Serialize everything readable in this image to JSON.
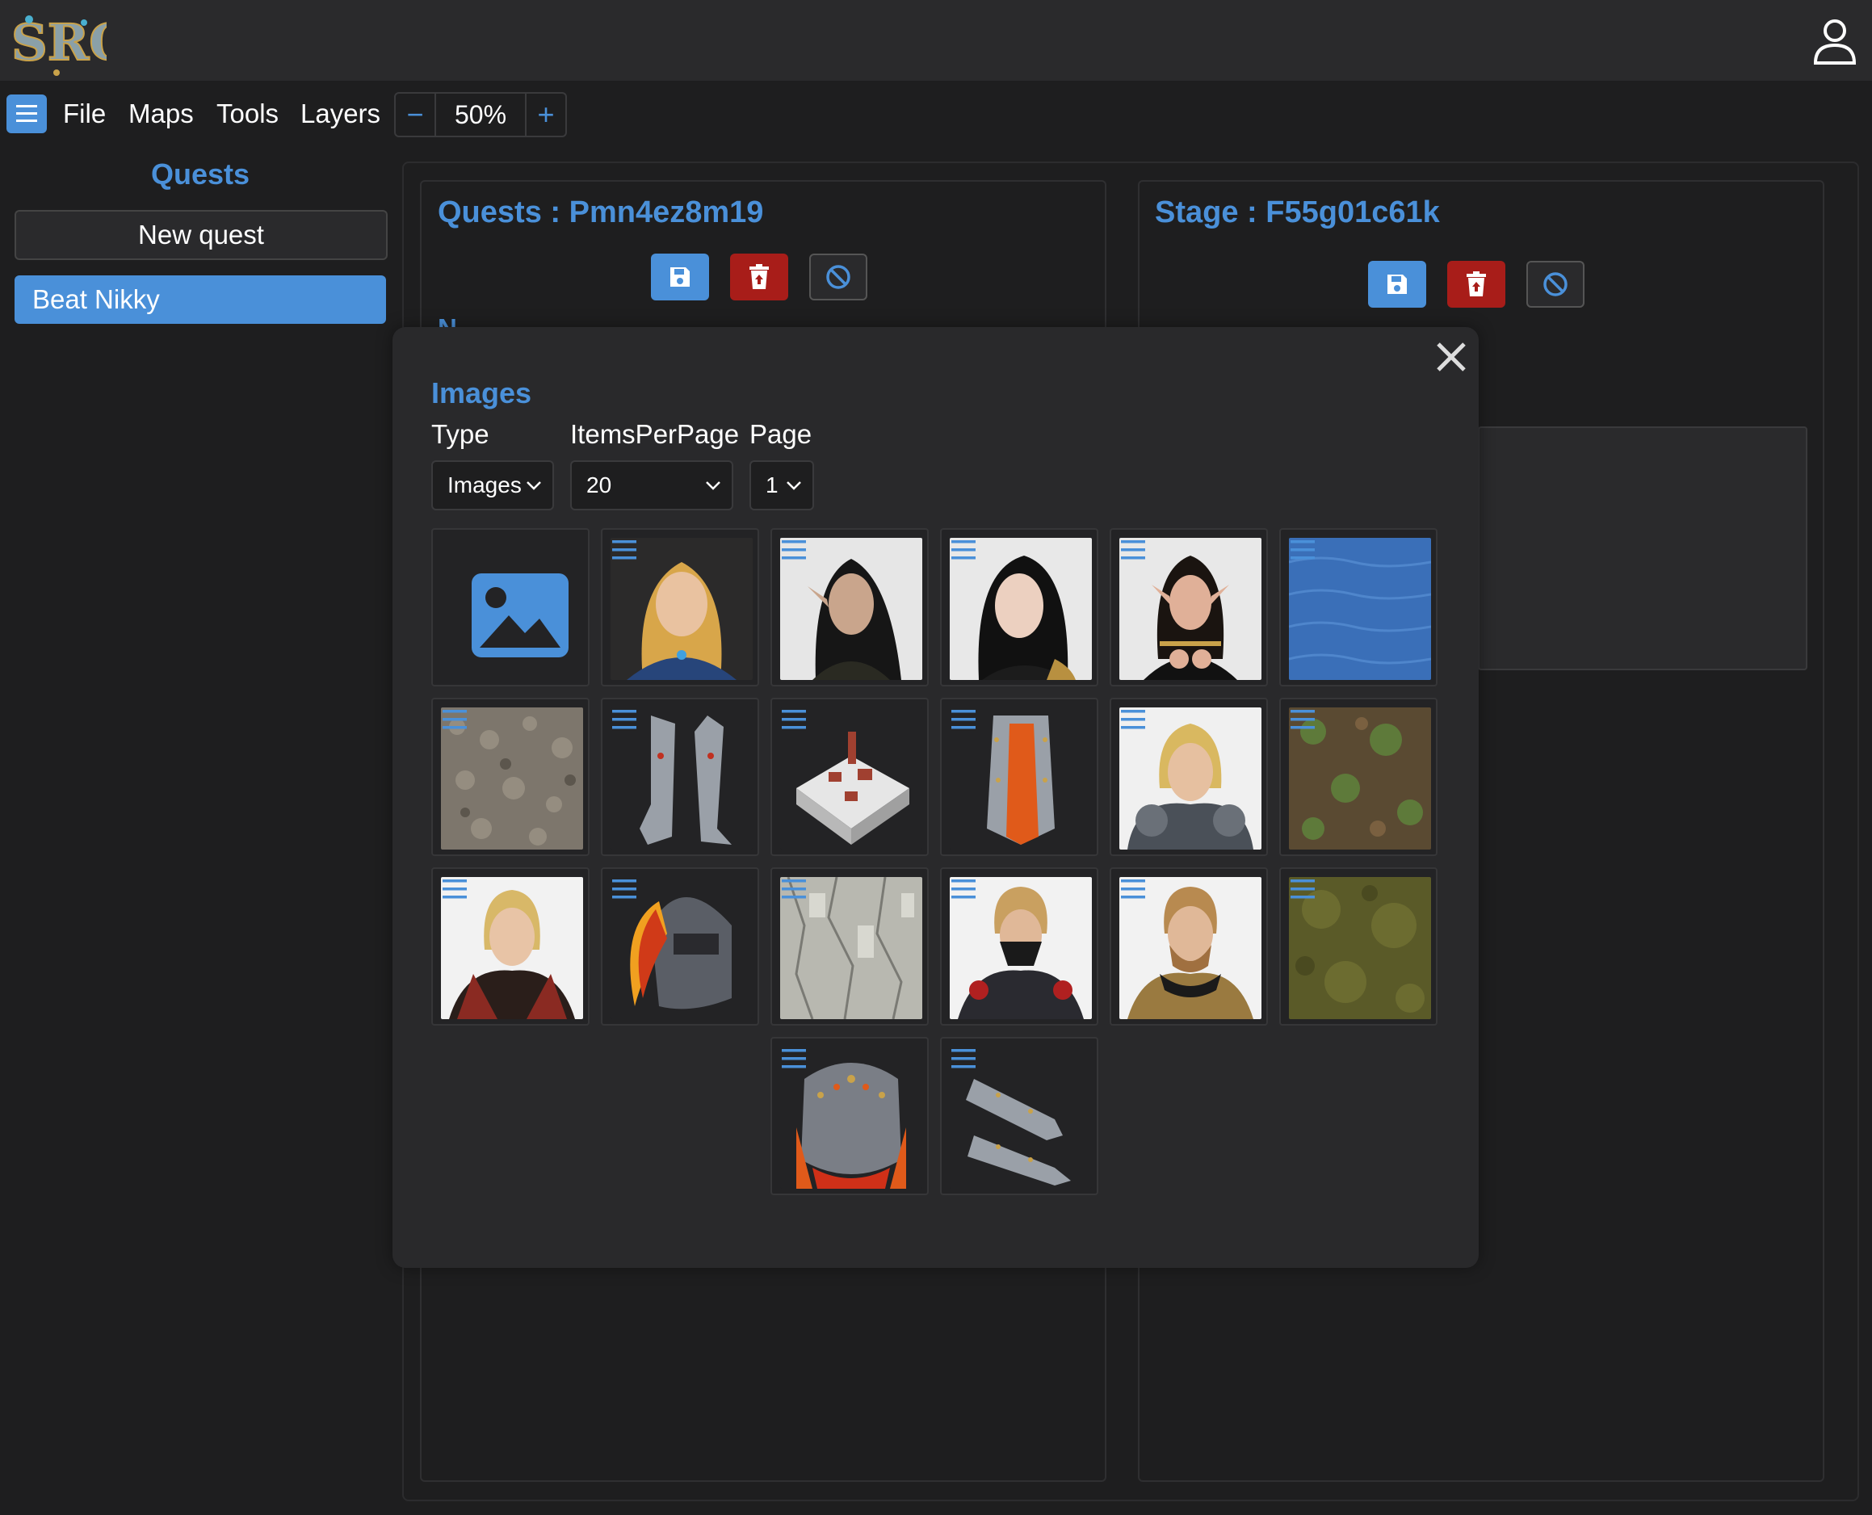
{
  "header": {
    "logo_text": "SRQ",
    "user_icon": "user-icon"
  },
  "menubar": {
    "hamburger_icon": "menu-icon",
    "items": [
      {
        "label": "File"
      },
      {
        "label": "Maps"
      },
      {
        "label": "Tools"
      },
      {
        "label": "Layers"
      }
    ],
    "zoom": {
      "minus": "−",
      "value": "50%",
      "plus": "+"
    }
  },
  "sidebar": {
    "title": "Quests",
    "new_button": "New quest",
    "items": [
      {
        "label": "Beat Nikky",
        "selected": true
      }
    ]
  },
  "quest_panel": {
    "title": "Quests : Pmn4ez8m19",
    "partial_label": "N"
  },
  "stage_panel": {
    "title": "Stage : F55g01c61k"
  },
  "modal": {
    "title": "Images",
    "fields": {
      "type_label": "Type",
      "items_label": "ItemsPerPage",
      "page_label": "Page"
    },
    "type_value": "Images",
    "items_value": "20",
    "page_value": "1",
    "tiles": [
      {
        "name": "add-image",
        "kind": "placeholder"
      },
      {
        "name": "blonde-woman-portrait",
        "kind": "portrait"
      },
      {
        "name": "elf-woman-portrait",
        "kind": "portrait"
      },
      {
        "name": "dark-haired-woman-portrait",
        "kind": "portrait"
      },
      {
        "name": "elf-woman-armor-portrait",
        "kind": "portrait"
      },
      {
        "name": "water-texture",
        "kind": "texture"
      },
      {
        "name": "gravel-texture",
        "kind": "texture"
      },
      {
        "name": "leg-armor-item",
        "kind": "item"
      },
      {
        "name": "castle-town-map",
        "kind": "item"
      },
      {
        "name": "armored-skirt-item",
        "kind": "item"
      },
      {
        "name": "armored-knight-portrait",
        "kind": "portrait"
      },
      {
        "name": "grass-dirt-texture",
        "kind": "texture"
      },
      {
        "name": "noble-man-portrait",
        "kind": "portrait"
      },
      {
        "name": "plumed-helmet-item",
        "kind": "item"
      },
      {
        "name": "rock-texture",
        "kind": "texture"
      },
      {
        "name": "masked-warrior-portrait",
        "kind": "portrait"
      },
      {
        "name": "bearded-knight-portrait",
        "kind": "portrait"
      },
      {
        "name": "moss-texture",
        "kind": "texture"
      },
      {
        "name": "chest-armor-item",
        "kind": "item"
      },
      {
        "name": "gauntlets-item",
        "kind": "item"
      }
    ]
  },
  "colors": {
    "accent": "#4a90d9",
    "danger": "#a81d19",
    "background": "#1e1e1f",
    "surface": "#29292b"
  }
}
